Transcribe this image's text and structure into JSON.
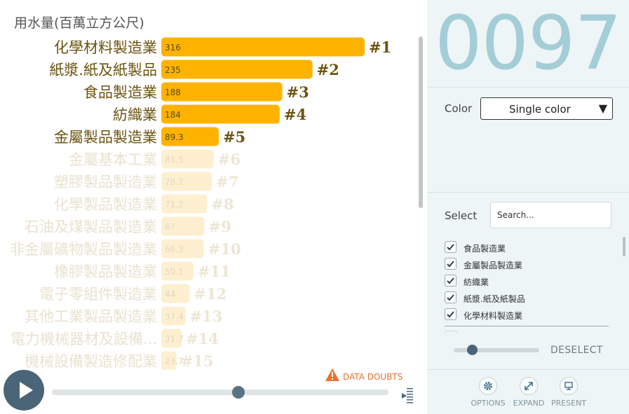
{
  "chart_data": {
    "type": "bar",
    "orientation": "horizontal",
    "title": "用水量(百萬立方公尺)",
    "year": "0097",
    "categories": [
      "化學材料製造業",
      "紙漿.紙及紙製品",
      "食品製造業",
      "紡織業",
      "金屬製品製造業",
      "金屬基本工業",
      "塑膠製品製造業",
      "化學製品製造業",
      "石油及煤製品製造業",
      "非金屬礦物製品製造業",
      "橡膠製品製造業",
      "電子零組件製造業",
      "其他工業製品製造業",
      "電力機械器材及設備...",
      "機械設備製造修配業"
    ],
    "values": [
      316,
      235,
      188,
      184,
      89.3,
      81.5,
      78.7,
      71.2,
      67,
      66.3,
      50.1,
      44,
      37.4,
      31.7,
      23.7
    ],
    "value_labels": [
      "316",
      "235",
      "188",
      "184",
      "89.3",
      "81.5",
      "78.7",
      "71.2",
      "67",
      "66.3",
      "50.1",
      "44",
      "37.4",
      "31.7",
      "23.7"
    ],
    "ranks": [
      "#1",
      "#2",
      "#3",
      "#4",
      "#5",
      "#6",
      "#7",
      "#8",
      "#9",
      "#10",
      "#11",
      "#12",
      "#13",
      "#14",
      "#15"
    ],
    "selected_count": 5,
    "colors": {
      "bar": "#ffb300",
      "bar_faded": "#fdefd0",
      "label": "#6b5410",
      "label_faded": "#e9e2cf",
      "rank": "#6b5410",
      "rank_faded": "#ede6d4",
      "value_text": "#5c4a12",
      "value_text_faded": "#e3d9bf"
    }
  },
  "controls": {
    "data_doubts": "DATA DOUBTS"
  },
  "sidebar": {
    "year": "0097",
    "color_label": "Color",
    "color_value": "Single color",
    "select_label": "Select",
    "search_placeholder": "Search...",
    "items": [
      "食品製造業",
      "金屬製品製造業",
      "紡織業",
      "紙漿.紙及紙製品",
      "化學材料製造業"
    ],
    "deselect": "DESELECT",
    "options": "OPTIONS",
    "expand": "EXPAND",
    "present": "PRESENT"
  }
}
